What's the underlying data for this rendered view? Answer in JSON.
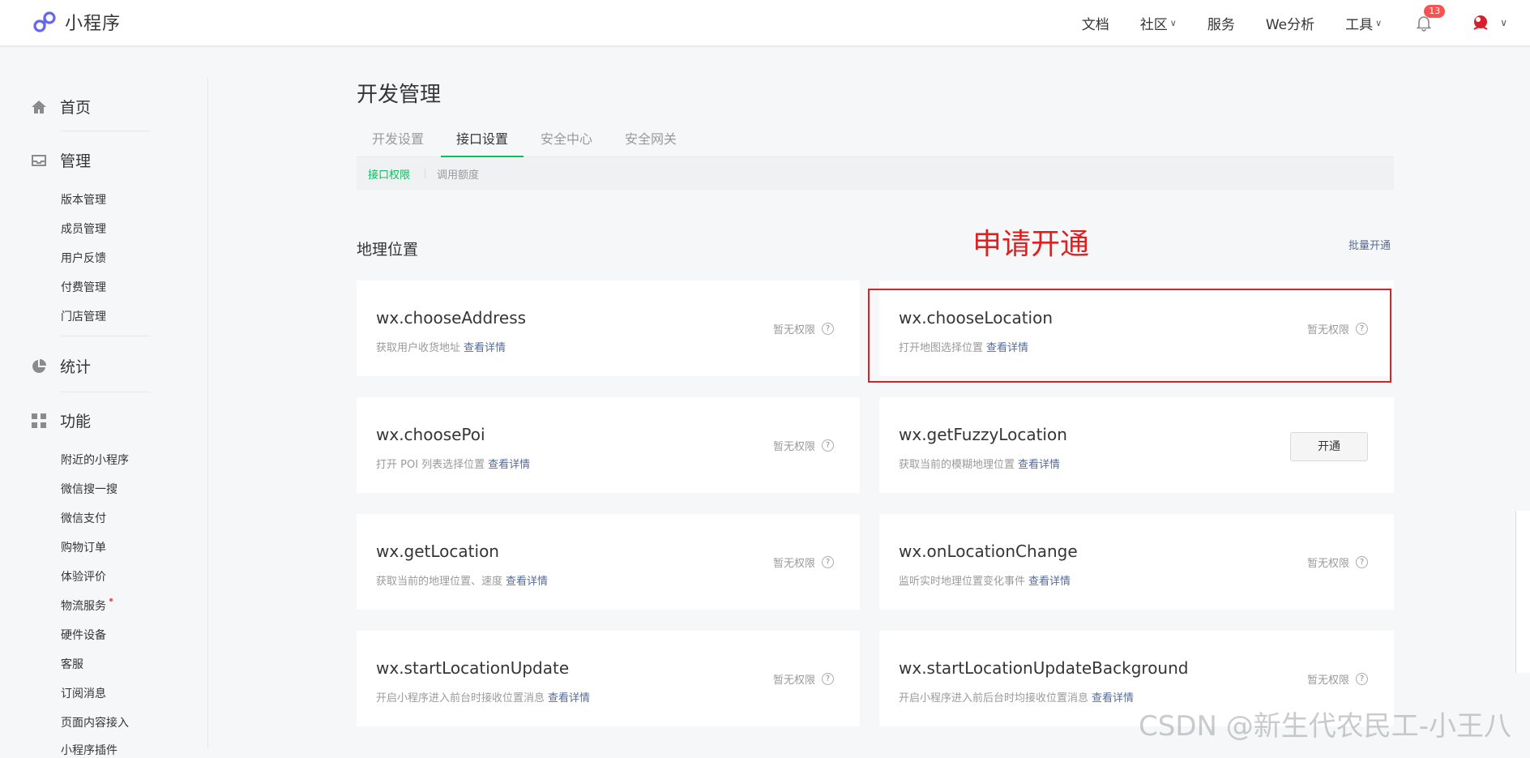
{
  "header": {
    "logo_text": "小程序",
    "nav": [
      {
        "label": "文档",
        "dropdown": false
      },
      {
        "label": "社区",
        "dropdown": true
      },
      {
        "label": "服务",
        "dropdown": false
      },
      {
        "label": "We分析",
        "dropdown": false
      },
      {
        "label": "工具",
        "dropdown": true
      }
    ],
    "notification_count": "13",
    "icons": {
      "bell": "bell-icon",
      "avatar": "avatar-icon",
      "chevron": "chevron-down-icon"
    }
  },
  "sidebar": {
    "home": "首页",
    "manage": "管理",
    "manage_items": [
      "版本管理",
      "成员管理",
      "用户反馈",
      "付费管理",
      "门店管理"
    ],
    "stats": "统计",
    "features": "功能",
    "feature_items": [
      "附近的小程序",
      "微信搜一搜",
      "微信支付",
      "购物订单",
      "体验评价",
      "物流服务",
      "硬件设备",
      "客服",
      "订阅消息",
      "页面内容接入",
      "小程序插件"
    ]
  },
  "main": {
    "title": "开发管理",
    "tabs": [
      "开发设置",
      "接口设置",
      "安全中心",
      "安全网关"
    ],
    "active_tab": "接口设置",
    "subtabs": [
      "接口权限",
      "调用额度"
    ],
    "section_title": "地理位置",
    "annotation": "申请开通",
    "batch_open": "批量开通",
    "detail_link": "查看详情",
    "cards": [
      {
        "name": "wx.chooseAddress",
        "desc": "获取用户收货地址",
        "status": "暂无权限"
      },
      {
        "name": "wx.chooseLocation",
        "desc": "打开地图选择位置",
        "status": "暂无权限"
      },
      {
        "name": "wx.choosePoi",
        "desc": "打开 POI 列表选择位置",
        "status": "暂无权限"
      },
      {
        "name": "wx.getFuzzyLocation",
        "desc": "获取当前的模糊地理位置",
        "button": "开通"
      },
      {
        "name": "wx.getLocation",
        "desc": "获取当前的地理位置、速度",
        "status": "暂无权限"
      },
      {
        "name": "wx.onLocationChange",
        "desc": "监听实时地理位置变化事件",
        "status": "暂无权限"
      },
      {
        "name": "wx.startLocationUpdate",
        "desc": "开启小程序进入前台时接收位置消息",
        "status": "暂无权限"
      },
      {
        "name": "wx.startLocationUpdateBackground",
        "desc": "开启小程序进入前后台时均接收位置消息",
        "status": "暂无权限"
      }
    ]
  },
  "watermark": "CSDN @新生代农民工-小王八",
  "colors": {
    "accent": "#07c160",
    "link": "#576b95",
    "annotation": "#e02020",
    "badge": "#fa5151"
  }
}
